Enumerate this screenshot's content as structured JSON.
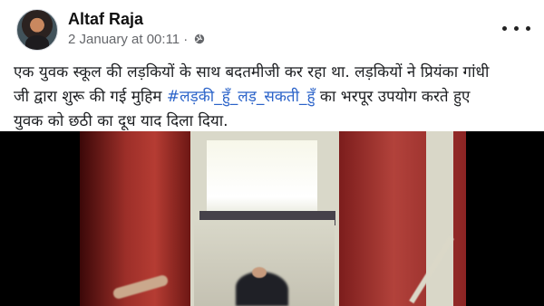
{
  "post": {
    "author": {
      "name": "Altaf Raja",
      "avatar_icon": "profile-avatar"
    },
    "timestamp": "2 January at 00:11 ·",
    "privacy_icon": "globe-icon",
    "more_icon": "more-options-icon",
    "caption": {
      "line1": "एक युवक स्कूल की लड़कियों के साथ बदतमीजी कर रहा था. लड़कियों ने प्रियंका गांधी",
      "line2_before": "जी द्वारा शुरू की गई मुहिम ",
      "hashtag": "#लड़की_हुँ_लड़_सकती_हुँ",
      "line2_after": " का भरपूर उपयोग करते हुए",
      "line3": "युवक को छठी का दूध याद दिला दिया."
    },
    "media": {
      "type": "video-still"
    }
  },
  "colors": {
    "author": "#111111",
    "meta": "#65676b",
    "body_text": "#1c1e21",
    "hashtag": "#2b63c9",
    "media_background": "#000000"
  }
}
